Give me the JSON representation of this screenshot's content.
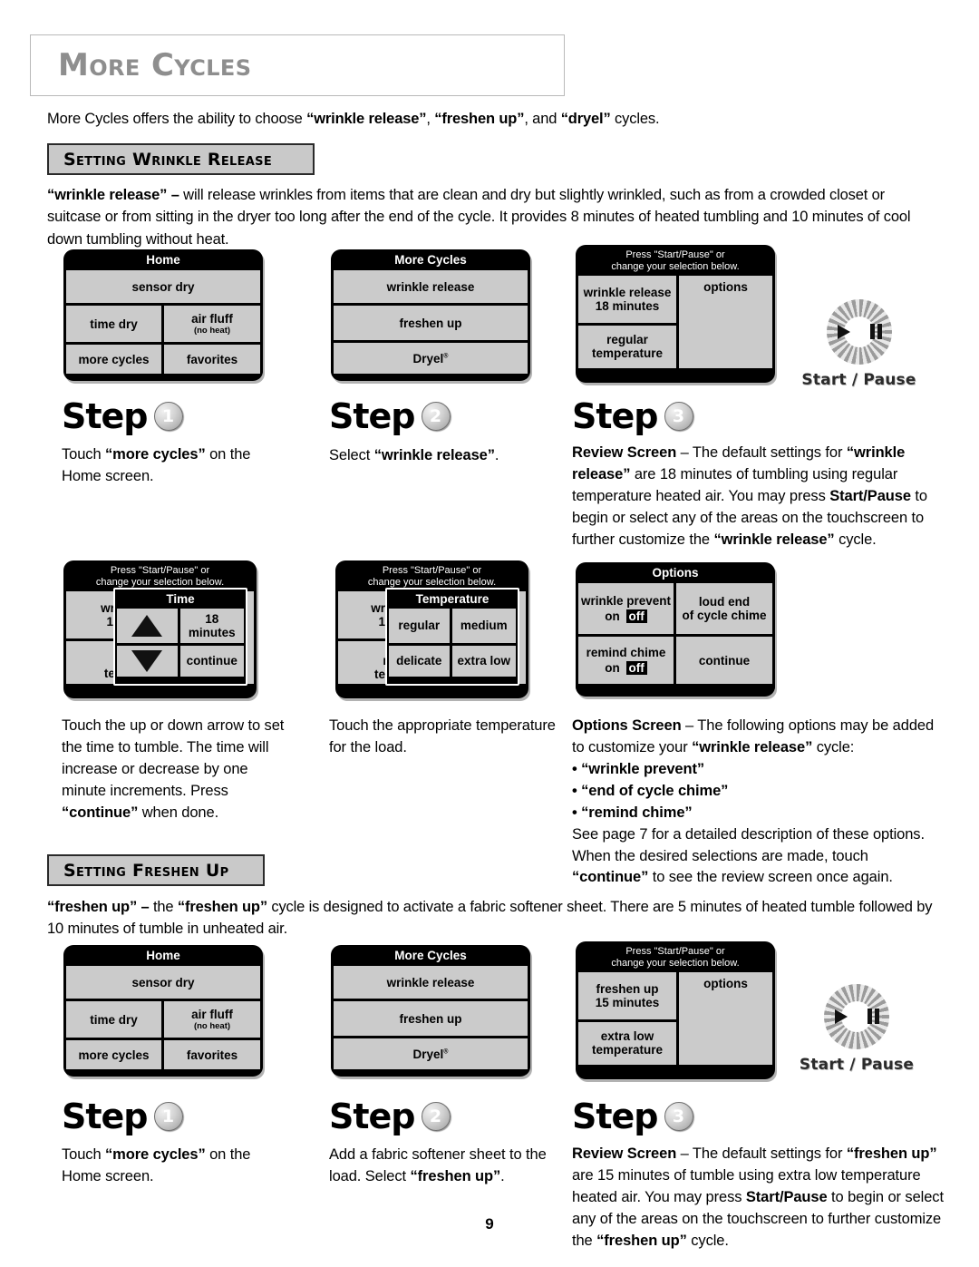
{
  "document": {
    "title": "More Cycles",
    "page_number": "9",
    "intro": {
      "pre": "More Cycles offers the ability to choose ",
      "b1": "“wrinkle release”",
      "mid1": ",  ",
      "b2": "“freshen up”",
      "mid2": ", and ",
      "b3": "“dryel”",
      "post": " cycles."
    }
  },
  "sections": {
    "wrinkle": {
      "header": "Setting Wrinkle Release",
      "paragraph": {
        "lead": "“wrinkle release” –",
        "rest": " will release wrinkles from items that are clean and dry but slightly wrinkled, such as from a crowded closet or suitcase or from sitting in the dryer too long after the end of the cycle. It provides 8 minutes of heated tumbling and 10 minutes of cool down tumbling without heat."
      }
    },
    "freshen": {
      "header": "Setting Freshen Up",
      "paragraph": {
        "lead": "“freshen up” –",
        "mid": " the ",
        "lead2": "“freshen up”",
        "rest": " cycle is designed to activate a fabric softener sheet. There are 5 minutes of heated tumble followed by 10 minutes of tumble in unheated air."
      }
    }
  },
  "screens": {
    "home": {
      "title": "Home",
      "row1": "sensor dry",
      "row2_left": "time dry",
      "row2_right": "air fluff",
      "row2_right_sub": "(no heat)",
      "row3_left": "more cycles",
      "row3_right": "favorites"
    },
    "more_cycles": {
      "title": "More Cycles",
      "row1": "wrinkle release",
      "row2": "freshen up",
      "row3": "Dryel",
      "row3_sup": "®"
    },
    "review_wrinkle": {
      "title_line1": "Press \"Start/Pause\" or",
      "title_line2": "change your selection below.",
      "cycle_line1": "wrinkle release",
      "cycle_line2": "18 minutes",
      "temp_line1": "regular",
      "temp_line2": "temperature",
      "options": "options"
    },
    "review_freshen": {
      "title_line1": "Press \"Start/Pause\" or",
      "title_line2": "change your selection below.",
      "cycle_line1": "freshen up",
      "cycle_line2": "15 minutes",
      "temp_line1": "extra low",
      "temp_line2": "temperature",
      "options": "options"
    },
    "time_overlay": {
      "title": "Time",
      "value_line1": "18",
      "value_line2": "minutes",
      "continue": "continue",
      "behind_left_line1": "wrin",
      "behind_left_line2": "18",
      "behind_left_line3": "ten",
      "arrow_up": "▲",
      "arrow_down": "▼"
    },
    "temp_overlay": {
      "title": "Temperature",
      "opt1": "regular",
      "opt2": "medium",
      "opt3": "delicate",
      "opt4": "extra low",
      "behind_left_line1": "wrinl",
      "behind_left_line2": "18",
      "behind_left_line3": "r",
      "behind_left_line4": "tem"
    },
    "options_screen": {
      "title": "Options",
      "cell1_line1": "wrinkle prevent",
      "cell1_on": "on",
      "cell1_off": "off",
      "cell2_line1": "loud end",
      "cell2_line2": "of cycle chime",
      "cell3_line1": "remind chime",
      "cell3_on": "on",
      "cell3_off": "off",
      "cell4": "continue"
    }
  },
  "knob": {
    "label": "Start / Pause",
    "play_icon": "play-icon",
    "pause_icon": "pause-icon"
  },
  "steps": {
    "wrinkle_1": {
      "word": "Step",
      "number": "1",
      "text_pre": "Touch ",
      "text_b": "“more cycles”",
      "text_post": " on the Home screen."
    },
    "wrinkle_2": {
      "word": "Step",
      "number": "2",
      "text_pre": "Select ",
      "text_b": "“wrinkle release”",
      "text_post": "."
    },
    "wrinkle_3": {
      "word": "Step",
      "number": "3",
      "b1": "Review Screen",
      "t1": " – The default settings for ",
      "b2": "“wrinkle release”",
      "t2": " are 18 minutes of tumbling using regular temperature heated air. You may press ",
      "b3": "Start/Pause",
      "t3": " to begin or select any of the areas on the touchscreen to further customize the ",
      "b4": "“wrinkle release”",
      "t4": " cycle."
    },
    "freshen_1": {
      "word": "Step",
      "number": "1",
      "text_pre": "Touch ",
      "text_b": "“more cycles”",
      "text_post": " on the Home screen."
    },
    "freshen_2": {
      "word": "Step",
      "number": "2",
      "text_pre": "Add a fabric softener sheet to the load.  Select ",
      "text_b": "“freshen up”",
      "text_post": "."
    },
    "freshen_3": {
      "word": "Step",
      "number": "3",
      "b1": "Review Screen",
      "t1": " – The default settings for ",
      "b2": "“freshen up”",
      "t2": " are 15 minutes of tumble using extra low temperature heated air. You may press ",
      "b3": "Start/Pause",
      "t3": " to begin or select any of the areas on the touchscreen to further customize the ",
      "b4": "“freshen up”",
      "t4": " cycle."
    }
  },
  "captions": {
    "time": "Touch the up or down arrow to set the time to tumble. The time will increase or decrease by one minute increments.  Press ",
    "time_b": "“continue”",
    "time_post": " when done.",
    "temperature": "Touch the appropriate temperature for the load.",
    "options": {
      "b1": "Options Screen",
      "t1": " – The following options may be added to customize your ",
      "b2": "“wrinkle release”",
      "t2": " cycle:",
      "bullets": [
        "• “wrinkle prevent”",
        "• “end of cycle chime”",
        "• “remind chime”"
      ],
      "t3": "See page 7 for a detailed description of these options. When the desired selections are made, touch ",
      "b3": "“continue”",
      "t4": " to see the review screen once again."
    }
  }
}
